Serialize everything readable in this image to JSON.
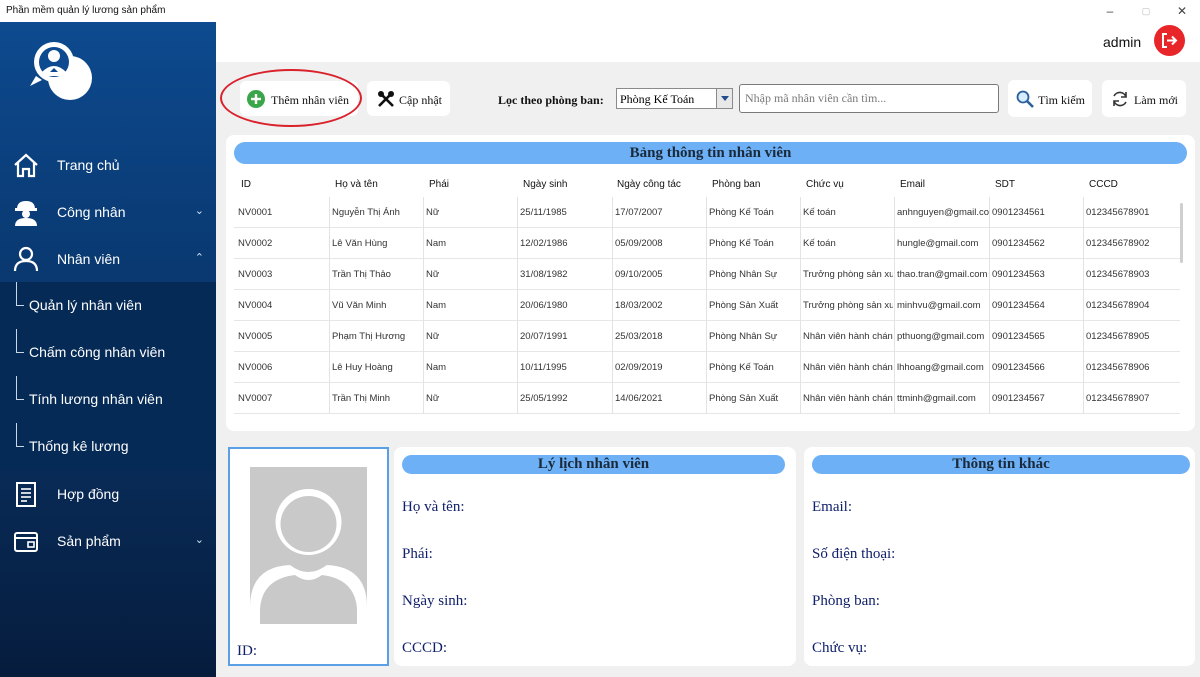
{
  "window": {
    "title": "Phần mềm quản lý lương sản phẩm",
    "controls": [
      "–",
      "▢",
      "✕"
    ]
  },
  "sidebar": {
    "items": [
      {
        "label": "Trang chủ",
        "icon": "home-icon",
        "chevron": ""
      },
      {
        "label": "Công nhân",
        "icon": "worker-icon",
        "chevron": "⌄"
      },
      {
        "label": "Nhân viên",
        "icon": "user-icon",
        "chevron": "⌃"
      },
      {
        "label": "Hợp đồng",
        "icon": "contract-icon",
        "chevron": ""
      },
      {
        "label": "Sản phẩm",
        "icon": "product-icon",
        "chevron": "⌄"
      }
    ],
    "subitems": [
      "Quản lý nhân viên",
      "Chấm công nhân viên",
      "Tính lương nhân viên",
      "Thống kê lương"
    ]
  },
  "header": {
    "user": "admin",
    "logout_icon": "logout-icon"
  },
  "toolbar": {
    "add_label": "Thêm nhân viên",
    "update_label": "Cập nhật",
    "filter_label": "Lọc theo phòng ban:",
    "department_selected": "Phòng Kế Toán",
    "search_placeholder": "Nhập mã nhân viên cần tìm...",
    "search_label": "Tìm kiếm",
    "refresh_label": "Làm mới"
  },
  "table": {
    "title": "Bảng thông tin nhân viên",
    "columns": [
      "ID",
      "Họ và tên",
      "Phái",
      "Ngày sinh",
      "Ngày công tác",
      "Phòng ban",
      "Chức vụ",
      "Email",
      "SDT",
      "CCCD"
    ],
    "rows": [
      [
        "NV0001",
        "Nguyễn Thị Ánh",
        "Nữ",
        "25/11/1985",
        "17/07/2007",
        "Phòng Kế Toán",
        "Kế toán",
        "anhnguyen@gmail.co...",
        "0901234561",
        "012345678901"
      ],
      [
        "NV0002",
        "Lê Văn Hùng",
        "Nam",
        "12/02/1986",
        "05/09/2008",
        "Phòng Kế Toán",
        "Kế toán",
        "hungle@gmail.com",
        "0901234562",
        "012345678902"
      ],
      [
        "NV0003",
        "Trần Thị Thảo",
        "Nữ",
        "31/08/1982",
        "09/10/2005",
        "Phòng Nhân Sự",
        "Trưởng phòng sản xu...",
        "thao.tran@gmail.com",
        "0901234563",
        "012345678903"
      ],
      [
        "NV0004",
        "Vũ Văn Minh",
        "Nam",
        "20/06/1980",
        "18/03/2002",
        "Phòng Sản Xuất",
        "Trưởng phòng sản xu...",
        "minhvu@gmail.com",
        "0901234564",
        "012345678904"
      ],
      [
        "NV0005",
        "Phạm Thị Hương",
        "Nữ",
        "20/07/1991",
        "25/03/2018",
        "Phòng Nhân Sự",
        "Nhân viên hành chánh",
        "pthuong@gmail.com",
        "0901234565",
        "012345678905"
      ],
      [
        "NV0006",
        "Lê Huy Hoàng",
        "Nam",
        "10/11/1995",
        "02/09/2019",
        "Phòng Kế Toán",
        "Nhân viên hành chánh",
        "lhhoang@gmail.com",
        "0901234566",
        "012345678906"
      ],
      [
        "NV0007",
        "Trần Thị Minh",
        "Nữ",
        "25/05/1992",
        "14/06/2021",
        "Phòng Sản Xuất",
        "Nhân viên hành chánh",
        "ttminh@gmail.com",
        "0901234567",
        "012345678907"
      ]
    ]
  },
  "profile": {
    "id_label": "ID:",
    "title": "Lý lịch nhân viên",
    "fields": [
      "Họ và tên:",
      "Phái:",
      "Ngày sinh:",
      "CCCD:"
    ]
  },
  "other": {
    "title": "Thông tin khác",
    "fields": [
      "Email:",
      "Số điện thoại:",
      "Phòng ban:",
      "Chức vụ:"
    ]
  },
  "colors": {
    "sidebar": "#0a3a73",
    "accent": "#6eb0f5",
    "logout": "#e8262a",
    "add_icon": "#3aa64a",
    "highlight_ring": "#d9222b"
  }
}
